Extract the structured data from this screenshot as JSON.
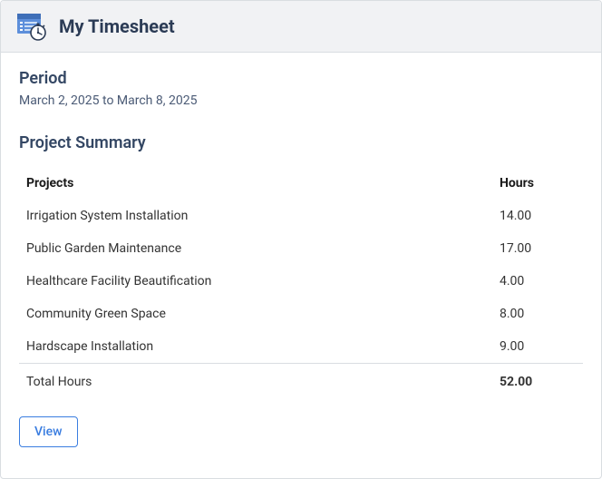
{
  "header": {
    "title": "My Timesheet",
    "icon": "timesheet-icon"
  },
  "period": {
    "label": "Period",
    "range": "March 2, 2025 to March 8, 2025"
  },
  "summary": {
    "heading": "Project Summary",
    "columns": {
      "projects": "Projects",
      "hours": "Hours"
    },
    "rows": [
      {
        "project": "Irrigation System Installation",
        "hours": "14.00"
      },
      {
        "project": "Public Garden Maintenance",
        "hours": "17.00"
      },
      {
        "project": "Healthcare Facility Beautification",
        "hours": "4.00"
      },
      {
        "project": "Community Green Space",
        "hours": "8.00"
      },
      {
        "project": "Hardscape Installation",
        "hours": "9.00"
      }
    ],
    "total": {
      "label": "Total Hours",
      "hours": "52.00"
    }
  },
  "actions": {
    "view": "View"
  }
}
